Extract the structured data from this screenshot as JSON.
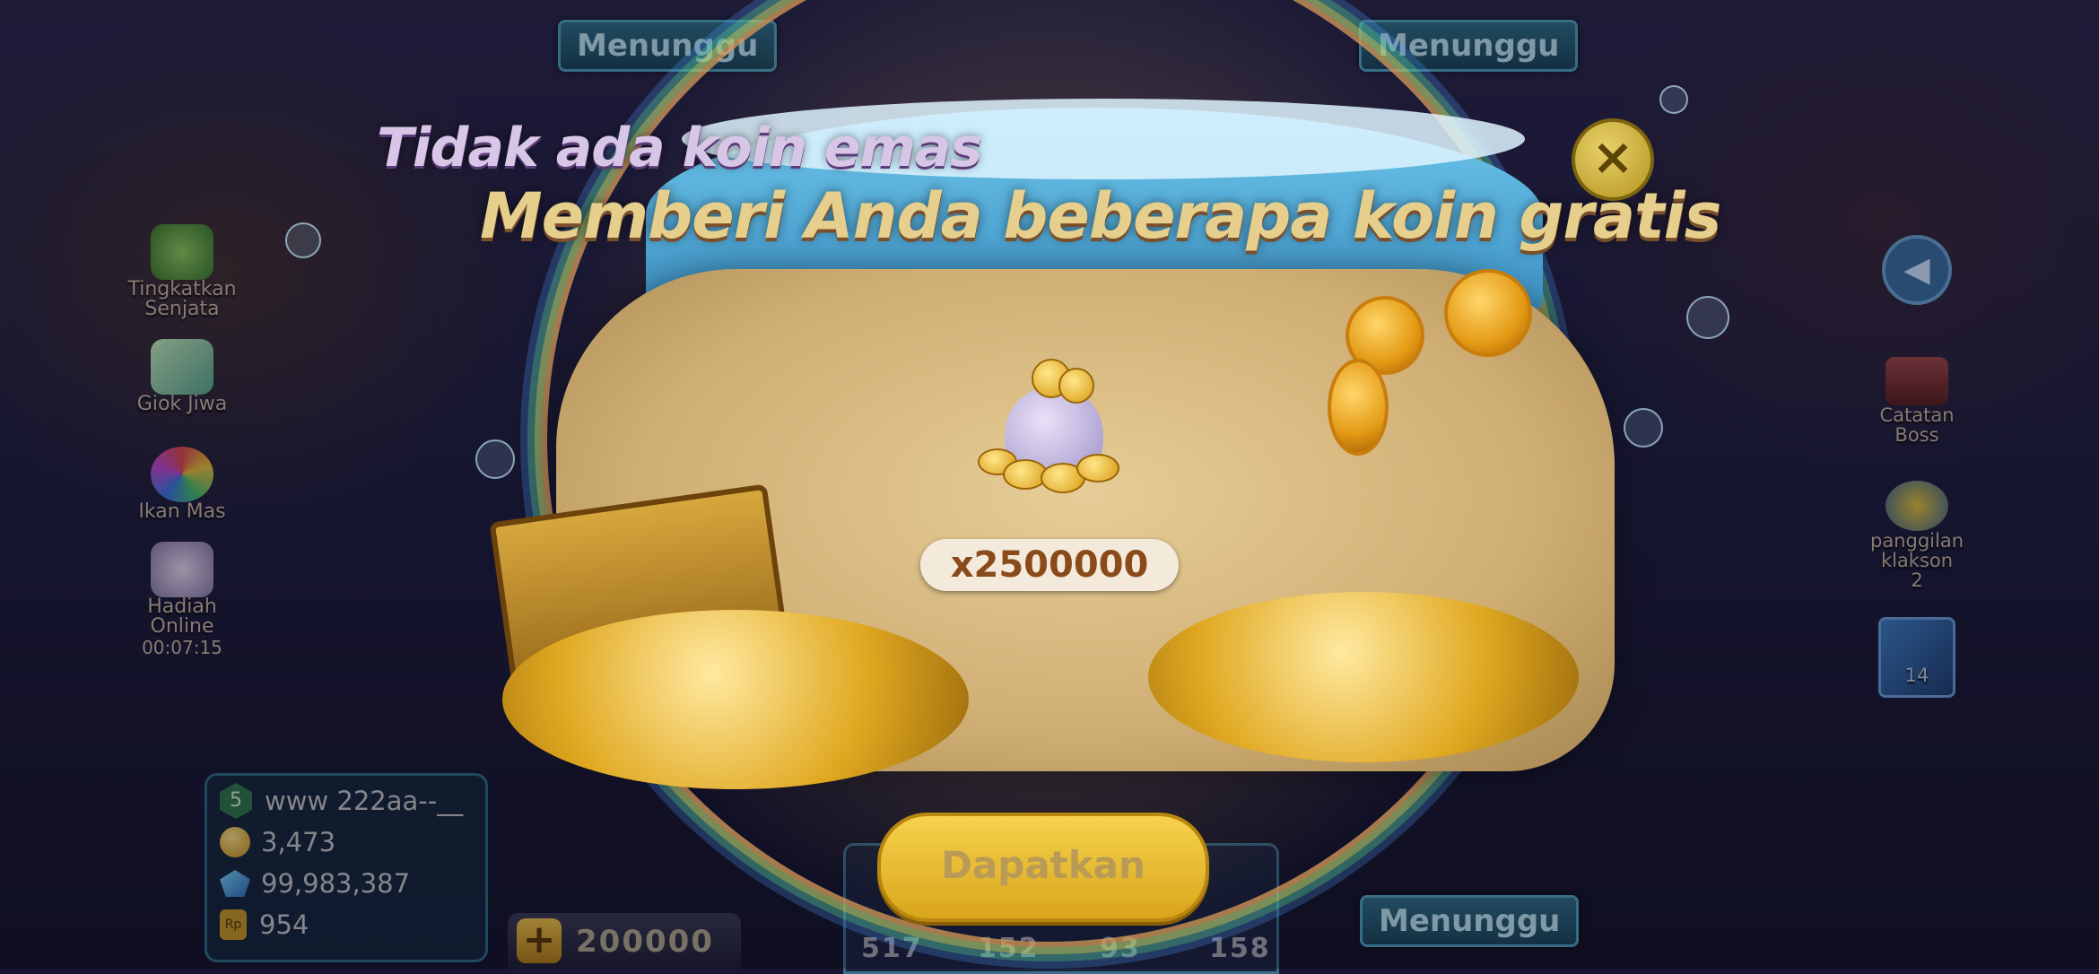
{
  "seats": {
    "top_left": "Menunggu",
    "top_right": "Menunggu",
    "bottom_right": "Menunggu"
  },
  "left_menu": [
    {
      "label": "Tingkatkan Senjata",
      "icon": "weapon-upgrade-icon"
    },
    {
      "label": "Giok Jiwa",
      "icon": "jade-crystal-icon"
    },
    {
      "label": "Ikan Mas",
      "icon": "golden-fish-wheel-icon"
    },
    {
      "label": "Hadiah Online",
      "icon": "online-gift-icon",
      "timer": "00:07:15"
    }
  ],
  "right_menu": [
    {
      "label": "Catatan Boss",
      "icon": "boss-record-icon"
    },
    {
      "label": "panggilan klakson",
      "icon": "horn-call-icon",
      "count": "2"
    },
    {
      "label": "",
      "icon": "missile-card-icon",
      "count": "14"
    }
  ],
  "player": {
    "level": "5",
    "name": "www  222aa--__",
    "coins": "3,473",
    "gems": "99,983,387",
    "rp": "954",
    "rp_icon_text": "Rp"
  },
  "bet": {
    "plus": "+",
    "amount": "200000"
  },
  "skills": [
    "517",
    "152",
    "93",
    "158"
  ],
  "dialog": {
    "title_line1": "Tidak ada koin emas",
    "title_line2": "Memberi Anda beberapa koin gratis",
    "reward_amount": "x2500000",
    "claim_button": "Dapatkan",
    "close_glyph": "×"
  },
  "colors": {
    "gold": "#f6d24d",
    "pill_text": "#8b4a1a",
    "seat_border": "#4fa4bf"
  }
}
